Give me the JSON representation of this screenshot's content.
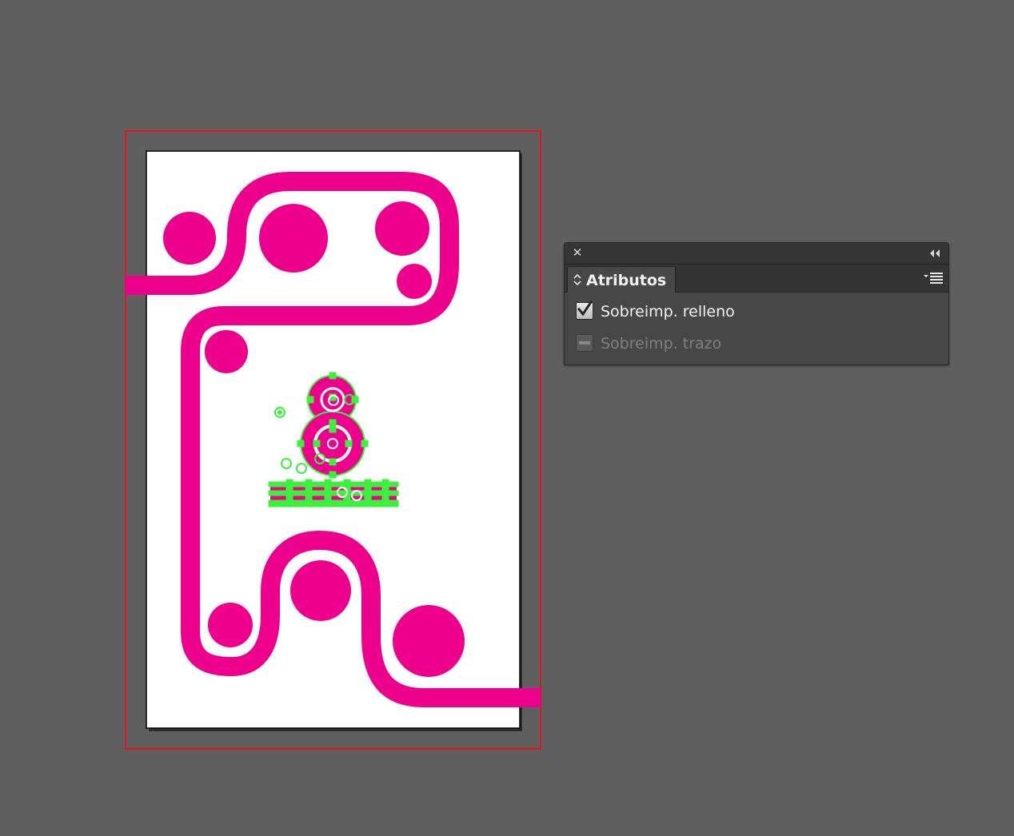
{
  "canvas": {
    "background_color": "#5f5f5f",
    "bleed_color": "#e0161e",
    "artwork_color": "#ec008c",
    "selection_color": "#3ef03e"
  },
  "panel": {
    "close_icon": "close-icon",
    "collapse_icon": "double-chevron-left-icon",
    "tab_title": "Atributos",
    "tab_icon": "updown-arrows-icon",
    "menu_icon": "panel-menu-icon",
    "options": [
      {
        "label": "Sobreimp. relleno",
        "checked": true,
        "enabled": true
      },
      {
        "label": "Sobreimp. trazo",
        "checked": false,
        "enabled": false
      }
    ]
  }
}
